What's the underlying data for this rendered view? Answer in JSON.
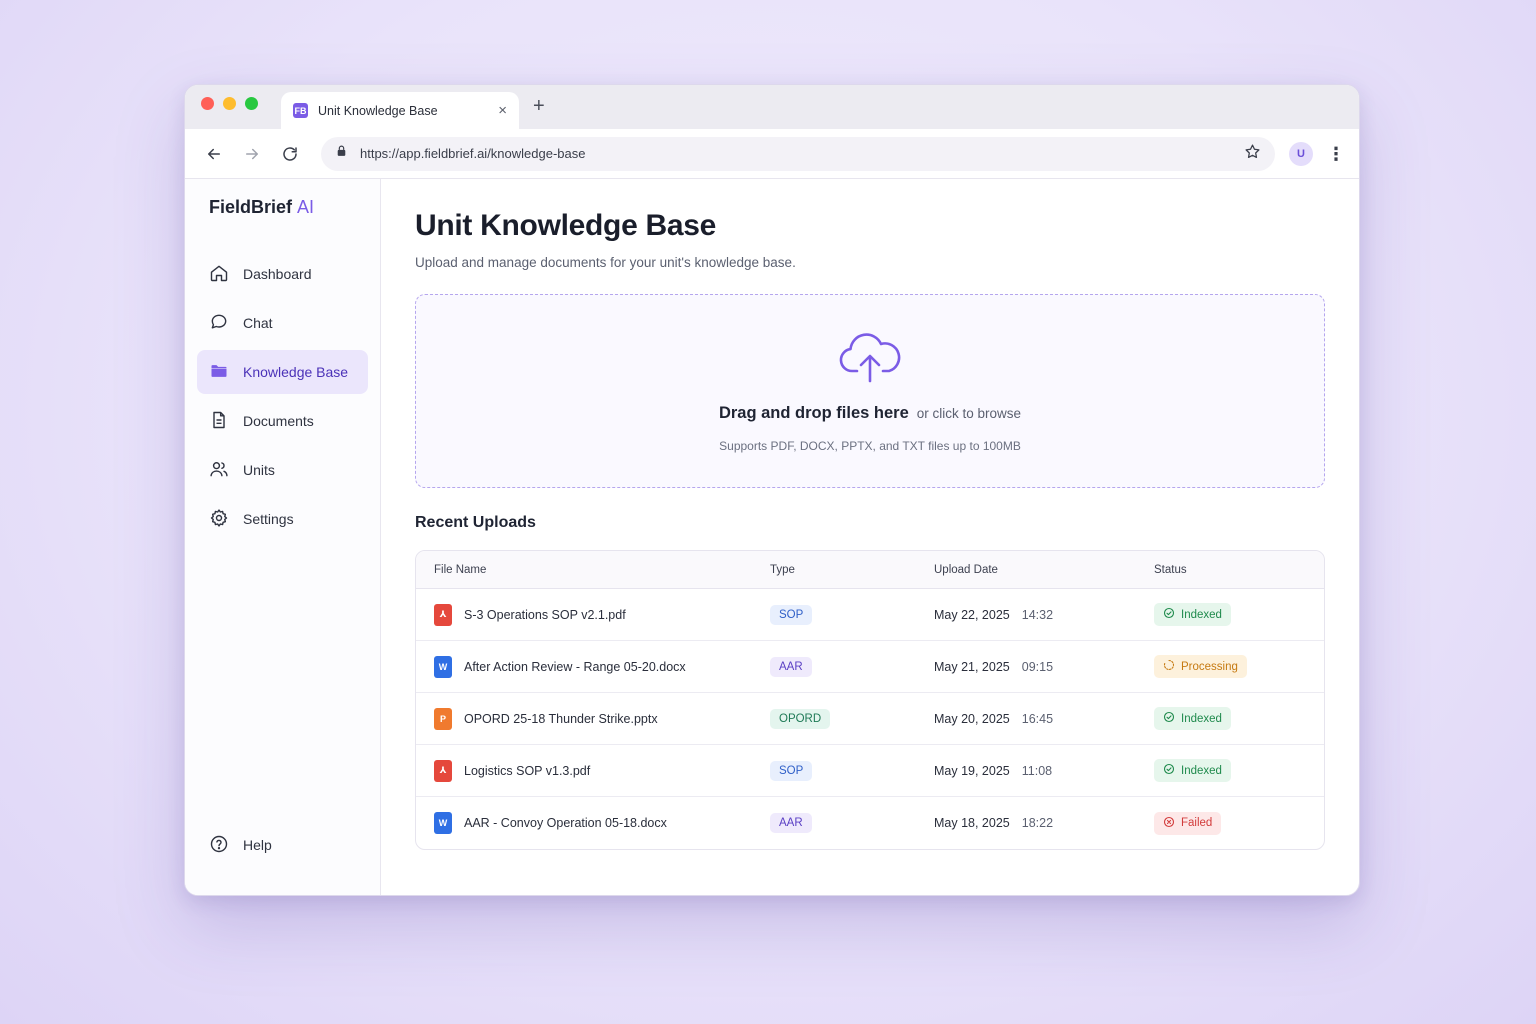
{
  "browser": {
    "tab_title": "Unit Knowledge Base",
    "tab_favicon": "FB",
    "url": "https://app.fieldbrief.ai/knowledge-base",
    "profile_initial": "U",
    "icons": [
      "back-icon",
      "forward-icon",
      "reload-icon",
      "lock-icon",
      "star-icon",
      "close-icon",
      "plus-icon",
      "more-vertical-icon"
    ]
  },
  "brand": {
    "name": "FieldBrief",
    "suffix": "AI"
  },
  "sidebar": {
    "items": [
      {
        "label": "Dashboard",
        "icon": "home-icon",
        "active": false
      },
      {
        "label": "Chat",
        "icon": "chat-icon",
        "active": false
      },
      {
        "label": "Knowledge Base",
        "icon": "folder-icon",
        "active": true
      },
      {
        "label": "Documents",
        "icon": "document-icon",
        "active": false
      },
      {
        "label": "Units",
        "icon": "users-icon",
        "active": false
      },
      {
        "label": "Settings",
        "icon": "gear-icon",
        "active": false
      }
    ],
    "help": {
      "label": "Help",
      "icon": "help-icon"
    }
  },
  "page": {
    "title": "Unit Knowledge Base",
    "subtitle": "Upload and manage documents for your unit's knowledge base."
  },
  "upload": {
    "icon": "cloud-upload-icon",
    "primary": "Drag and drop files here",
    "secondary": "or click to browse",
    "hint": "Supports PDF, DOCX, PPTX, and TXT files up to 100MB"
  },
  "recent": {
    "title": "Recent Uploads",
    "columns": [
      "File Name",
      "Type",
      "Upload Date",
      "Status"
    ],
    "rows": [
      {
        "file": "S-3 Operations SOP v2.1.pdf",
        "kind": "pdf",
        "type": "SOP",
        "date": "May 22, 2025",
        "time": "14:32",
        "status": "Indexed"
      },
      {
        "file": "After Action Review - Range 05-20.docx",
        "kind": "docx",
        "type": "AAR",
        "date": "May 21, 2025",
        "time": "09:15",
        "status": "Processing"
      },
      {
        "file": "OPORD 25-18 Thunder Strike.pptx",
        "kind": "pptx",
        "type": "OPORD",
        "date": "May 20, 2025",
        "time": "16:45",
        "status": "Indexed"
      },
      {
        "file": "Logistics SOP v1.3.pdf",
        "kind": "pdf",
        "type": "SOP",
        "date": "May 19, 2025",
        "time": "11:08",
        "status": "Indexed"
      },
      {
        "file": "AAR - Convoy Operation 05-18.docx",
        "kind": "docx",
        "type": "AAR",
        "date": "May 18, 2025",
        "time": "18:22",
        "status": "Failed"
      }
    ]
  },
  "colors": {
    "accent": "#7b5ce6",
    "pdf": "#e5483c",
    "docx": "#2f6fe4",
    "pptx": "#f07a2e",
    "sop_bg": "#e8effd",
    "sop_fg": "#2f5fc8",
    "aar_bg": "#efeafc",
    "aar_fg": "#5a3fc4",
    "opord_bg": "#e4f5ee",
    "opord_fg": "#1f7a56",
    "indexed_bg": "#e6f6ec",
    "indexed_fg": "#1f8a4c",
    "processing_bg": "#fdf1dc",
    "processing_fg": "#c67a12",
    "failed_bg": "#fde8e8",
    "failed_fg": "#d23b3b"
  }
}
